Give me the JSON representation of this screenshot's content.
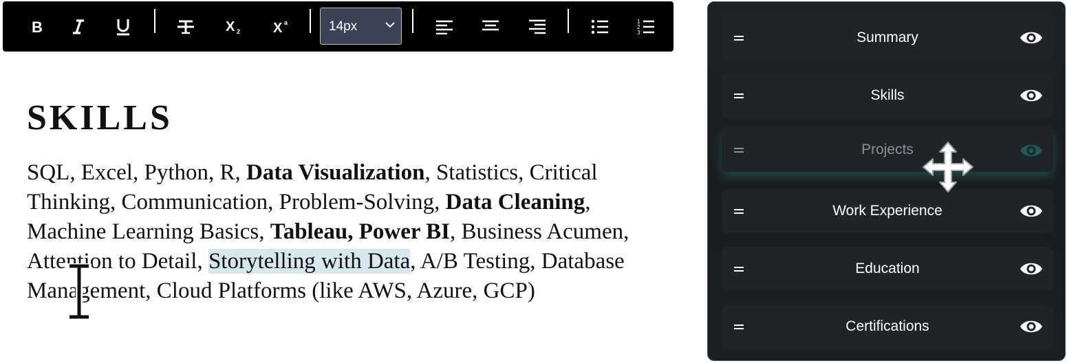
{
  "toolbar": {
    "bold_icon": "bold-icon",
    "italic_icon": "italic-icon",
    "underline_icon": "underline-icon",
    "strikethrough_icon": "strikethrough-icon",
    "subscript_icon": "subscript-icon",
    "superscript_icon": "superscript-icon",
    "font_size": "14px",
    "align_left_icon": "align-left-icon",
    "align_center_icon": "align-center-icon",
    "align_right_icon": "align-right-icon",
    "bullet_list_icon": "bullet-list-icon",
    "numbered_list_icon": "numbered-list-icon"
  },
  "editor": {
    "heading": "SKILLS",
    "segments": {
      "s1": "SQL, Excel, Python, R, ",
      "b1": "Data Visualization",
      "s2": ", Statistics, Critical Thinking, Communication, Problem-Solving, ",
      "b2": "Data Cleaning",
      "s3": ", Machine Learning Basics, ",
      "b3": "Tableau, Power BI",
      "s4": ", Business Acumen, Attention to Detail, ",
      "h1": "Storytelling with Data",
      "s5": ", A/B Testing, Database Management, Cloud Platforms (like AWS, Azure, GCP)"
    },
    "highlight_color": "#d7e7ee"
  },
  "panel": {
    "sections": [
      {
        "label": "Summary",
        "visible": true
      },
      {
        "label": "Skills",
        "visible": true
      },
      {
        "label": "Projects",
        "visible": true,
        "dragging": true
      },
      {
        "label": "Work Experience",
        "visible": true
      },
      {
        "label": "Education",
        "visible": true
      },
      {
        "label": "Certifications",
        "visible": true
      }
    ],
    "accent_color": "#1f5c57"
  }
}
